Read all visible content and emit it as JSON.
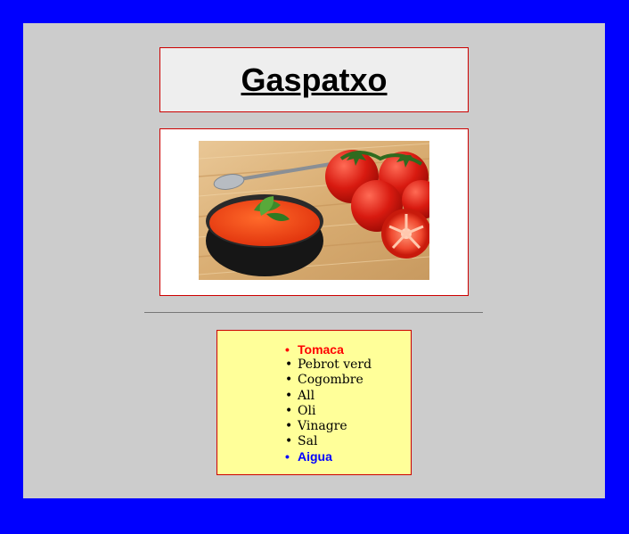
{
  "title": "Gaspatxo",
  "image": {
    "subject": "gazpacho-bowl-with-tomatoes"
  },
  "ingredients": [
    "Tomaca",
    "Pebrot verd",
    "Cogombre",
    "All",
    "Oli",
    "Vinagre",
    "Sal",
    "Aigua"
  ],
  "colors": {
    "frame": "#0000ff",
    "page": "#cccccc",
    "box_border": "#cc0000",
    "title_box": "#eeeeee",
    "list_box": "#ffff99",
    "first_item": "#ff0000",
    "last_item": "#0000ff"
  }
}
